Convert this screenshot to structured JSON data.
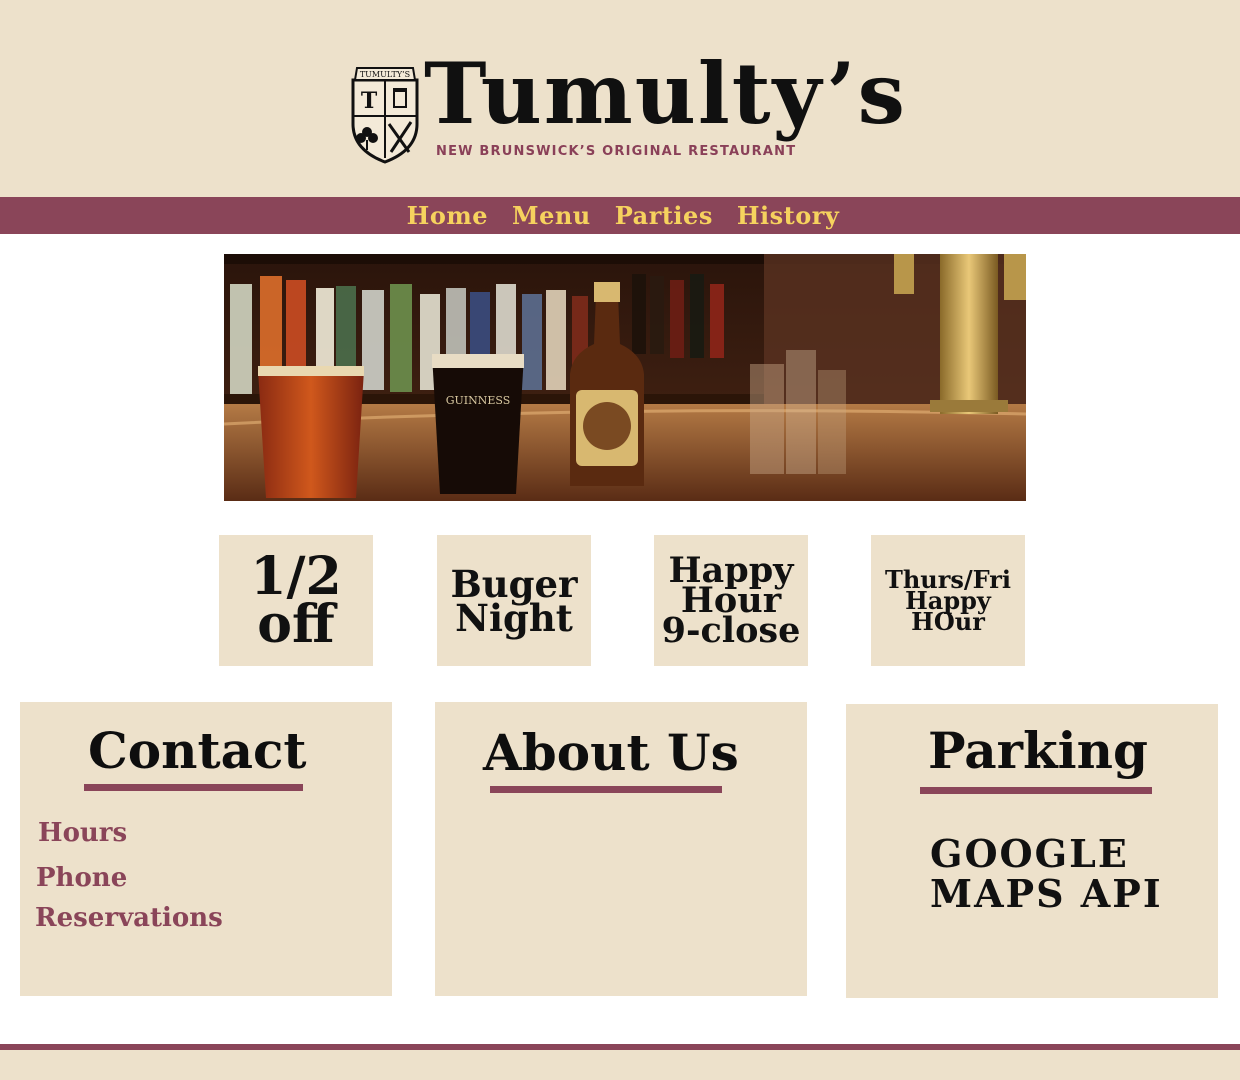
{
  "brand": {
    "name": "Tumulty’s",
    "tagline": "NEW BRUNSWICK’S ORIGINAL RESTAURANT",
    "crest_text": "TUMULTY’S"
  },
  "nav": {
    "items": [
      {
        "label": "Home"
      },
      {
        "label": "Menu"
      },
      {
        "label": "Parties"
      },
      {
        "label": "History"
      }
    ]
  },
  "hero": {
    "glass_label": "GUINNESS"
  },
  "promos": [
    {
      "label": "1/2\noff"
    },
    {
      "label": "Buger\nNight"
    },
    {
      "label": "Happy\nHour\n9-close"
    },
    {
      "label": "Thurs/Fri\nHappy\nHOur"
    }
  ],
  "contact": {
    "title": "Contact",
    "links": [
      {
        "label": "Hours"
      },
      {
        "label": "Phone"
      },
      {
        "label": "Reservations"
      }
    ]
  },
  "about": {
    "title": "About Us"
  },
  "parking": {
    "title": "Parking",
    "body": "GOOGLE\nMAPS API"
  },
  "colors": {
    "cream": "#ede1cb",
    "maroon": "#8a4559",
    "nav_text": "#f6d25e",
    "text_dark": "#111111"
  }
}
